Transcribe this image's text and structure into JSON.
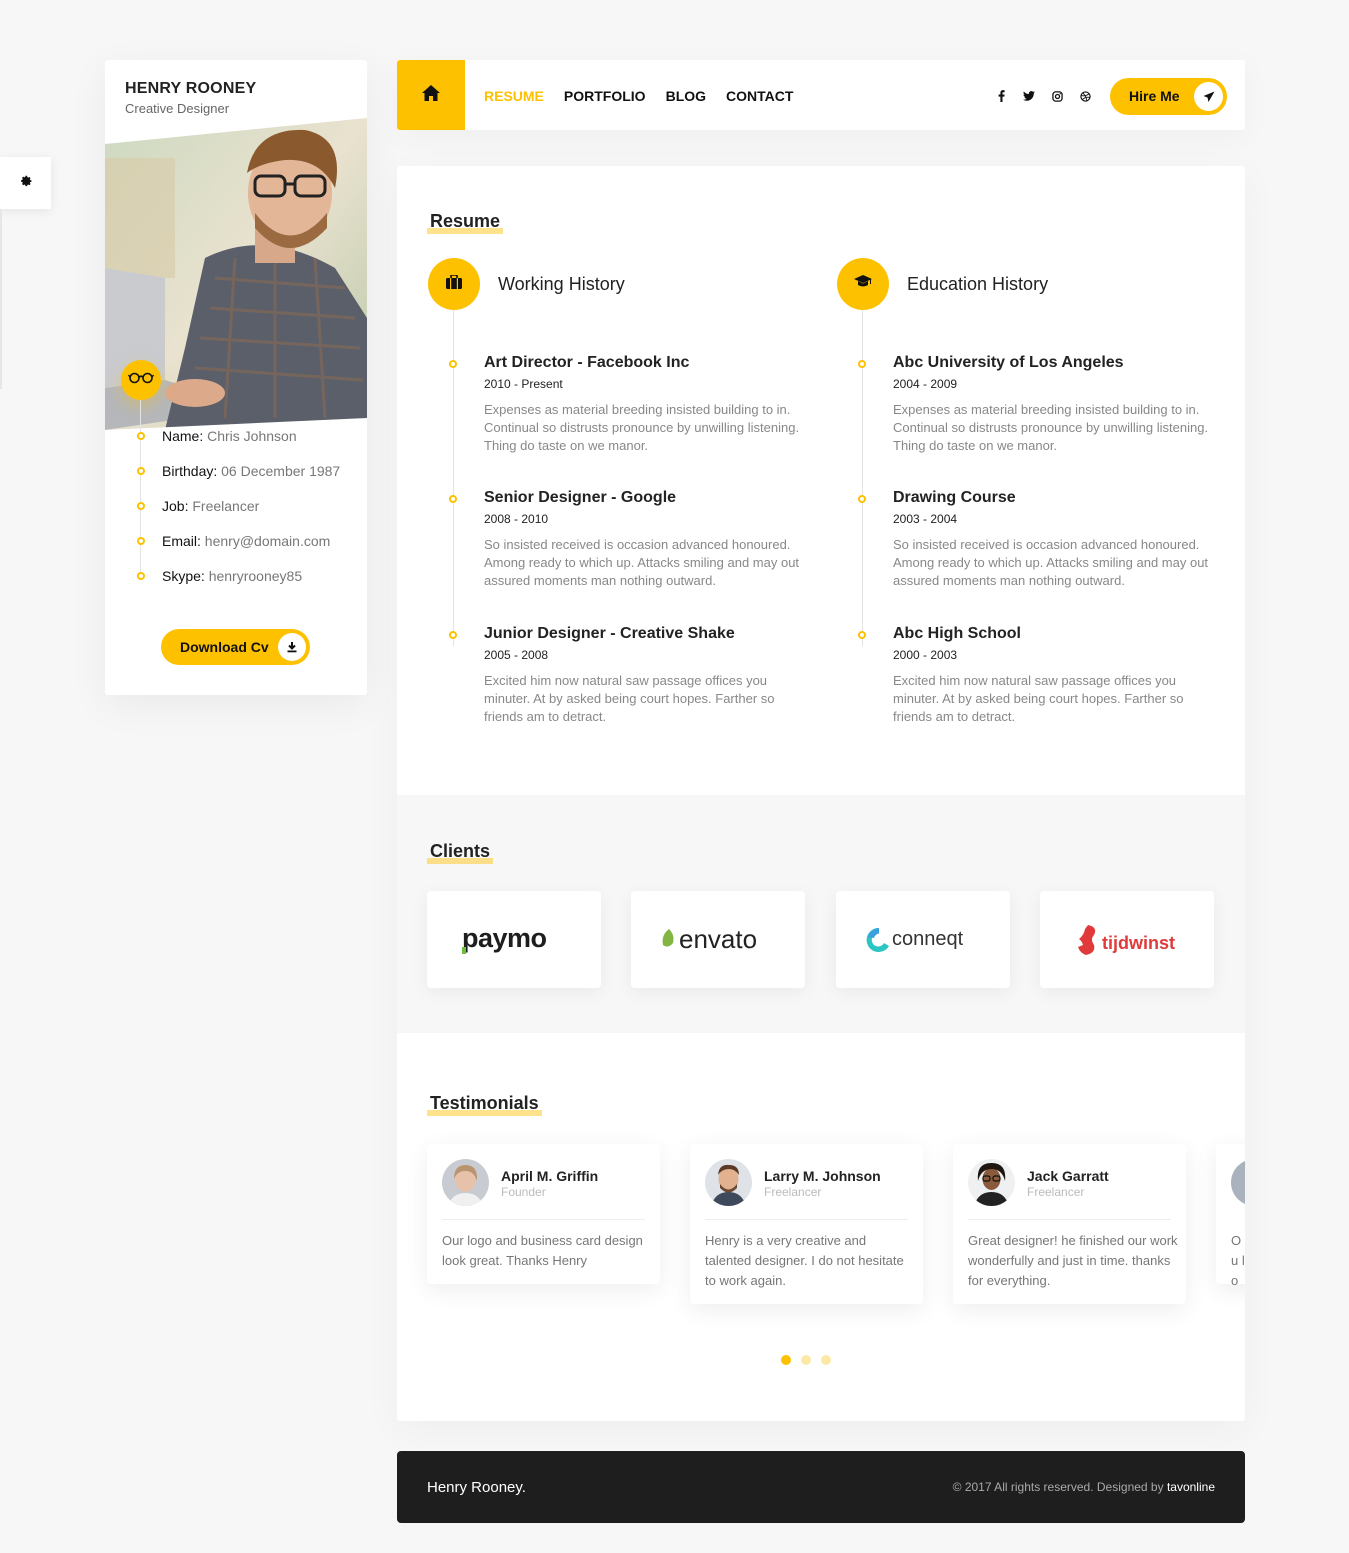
{
  "profile": {
    "name": "HENRY ROONEY",
    "role": "Creative Designer",
    "info": [
      {
        "label": "Name:",
        "value": "Chris Johnson"
      },
      {
        "label": "Birthday:",
        "value": "06 December 1987"
      },
      {
        "label": "Job:",
        "value": "Freelancer"
      },
      {
        "label": "Email:",
        "value": "henry@domain.com"
      },
      {
        "label": "Skype:",
        "value": "henryrooney85"
      }
    ],
    "download_label": "Download Cv"
  },
  "nav": {
    "menu": [
      "RESUME",
      "PORTFOLIO",
      "BLOG",
      "CONTACT"
    ],
    "active": "RESUME",
    "social_icons": [
      "facebook-icon",
      "twitter-icon",
      "instagram-icon",
      "dribbble-icon"
    ],
    "hire_label": "Hire Me"
  },
  "resume": {
    "title": "Resume",
    "working": {
      "title": "Working History",
      "items": [
        {
          "title": "Art Director - Facebook Inc",
          "years": "2010 - Present",
          "desc": "Expenses as material breeding insisted building to in. Continual so distrusts pronounce by unwilling listening. Thing do taste on we manor."
        },
        {
          "title": "Senior Designer - Google",
          "years": "2008 - 2010",
          "desc": "So insisted received is occasion advanced honoured. Among ready to which up. Attacks smiling and may out assured moments man nothing outward."
        },
        {
          "title": "Junior Designer - Creative Shake",
          "years": "2005 - 2008",
          "desc": "Excited him now natural saw passage offices you minuter. At by asked being court hopes. Farther so friends am to detract."
        }
      ]
    },
    "education": {
      "title": "Education History",
      "items": [
        {
          "title": "Abc University of Los Angeles",
          "years": "2004 - 2009",
          "desc": "Expenses as material breeding insisted building to in. Continual so distrusts pronounce by unwilling listening. Thing do taste on we manor."
        },
        {
          "title": "Drawing Course",
          "years": "2003 - 2004",
          "desc": "So insisted received is occasion advanced honoured. Among ready to which up. Attacks smiling and may out assured moments man nothing outward."
        },
        {
          "title": "Abc High School",
          "years": "2000 - 2003",
          "desc": "Excited him now natural saw passage offices you minuter. At by asked being court hopes. Farther so friends am to detract."
        }
      ]
    }
  },
  "clients": {
    "title": "Clients",
    "logos": [
      "paymo",
      "envato",
      "conneqt",
      "tijdwinst"
    ]
  },
  "testimonials": {
    "title": "Testimonials",
    "items": [
      {
        "name": "April M. Griffin",
        "role": "Founder",
        "quote": "Our logo and business card design look great. Thanks Henry"
      },
      {
        "name": "Larry M. Johnson",
        "role": "Freelancer",
        "quote": "Henry is a very creative and talented designer. I do not hesitate to work again."
      },
      {
        "name": "Jack Garratt",
        "role": "Freelancer",
        "quote": "Great designer! he finished our work wonderfully and just in time. thanks for everything."
      },
      {
        "name": "",
        "role": "",
        "quote": "Ou lo"
      }
    ]
  },
  "footer": {
    "left": "Henry Rooney.",
    "right_prefix": "© 2017 All rights reserved. Designed by",
    "right_brand": "tavonline"
  },
  "colors": {
    "accent": "#fec100",
    "dark": "#1e1e1e",
    "text": "#222222",
    "muted": "#888888"
  }
}
